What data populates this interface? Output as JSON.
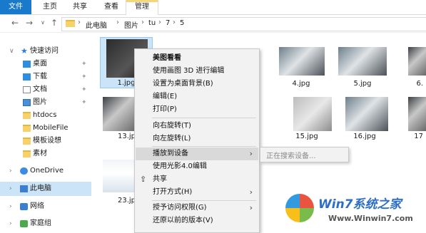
{
  "ribbon": {
    "tabs": [
      "文件",
      "主页",
      "共享",
      "查看",
      "管理"
    ]
  },
  "address": {
    "crumbs": [
      "此电脑",
      "图片",
      "tu",
      "7",
      "5"
    ]
  },
  "sidebar": {
    "quick_access": "快速访问",
    "items": [
      {
        "label": "桌面",
        "icon": "desktop-icon"
      },
      {
        "label": "下载",
        "icon": "download-icon"
      },
      {
        "label": "文档",
        "icon": "document-icon"
      },
      {
        "label": "图片",
        "icon": "picture-icon"
      },
      {
        "label": "htdocs",
        "icon": "folder-icon"
      },
      {
        "label": "MobileFile",
        "icon": "folder-icon"
      },
      {
        "label": "模板设想",
        "icon": "folder-icon"
      },
      {
        "label": "素材",
        "icon": "folder-icon"
      }
    ],
    "onedrive": "OneDrive",
    "this_pc": "此电脑",
    "network": "网络",
    "homegroup": "家庭组"
  },
  "files": [
    {
      "name": "1.jpg"
    },
    {
      "name": "4.jpg"
    },
    {
      "name": "5.jpg"
    },
    {
      "name": "6."
    },
    {
      "name": "13.jp"
    },
    {
      "name": "15.jpg"
    },
    {
      "name": "16.jpg"
    },
    {
      "name": "17"
    },
    {
      "name": "23.jp"
    }
  ],
  "context_menu": {
    "items": [
      {
        "label": "美图看看",
        "bold": true
      },
      {
        "label": "使用画图 3D 进行编辑"
      },
      {
        "label": "设置为桌面背景(B)"
      },
      {
        "label": "编辑(E)"
      },
      {
        "label": "打印(P)"
      },
      {
        "label": "向右旋转(T)"
      },
      {
        "label": "向左旋转(L)"
      },
      {
        "label": "播放到设备",
        "submenu": true
      },
      {
        "label": "使用光影4.0编辑"
      },
      {
        "label": "共享",
        "icon": "share-icon"
      },
      {
        "label": "打开方式(H)",
        "submenu": true
      },
      {
        "label": "授予访问权限(G)",
        "submenu": true
      },
      {
        "label": "还原以前的版本(V)"
      }
    ]
  },
  "submenu": {
    "searching": "正在搜索设备..."
  },
  "watermark": {
    "title": "Win7系统之家",
    "url": "Www.Winwin7.com"
  }
}
